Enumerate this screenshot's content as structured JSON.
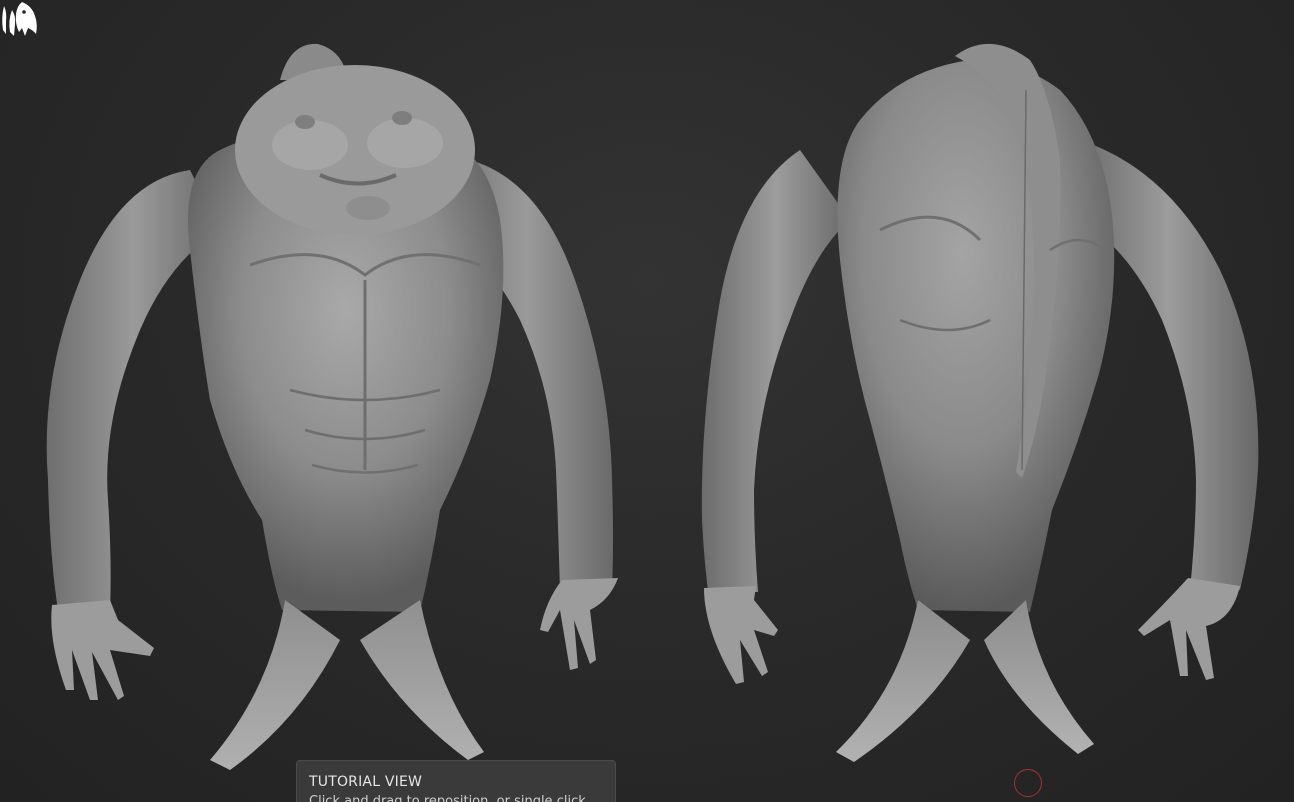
{
  "tutorial": {
    "title": "TUTORIAL VIEW",
    "body": "Click and drag to reposition, or single click"
  },
  "icons": {
    "logo": "zbrush-logo-icon",
    "cursor": "brush-cursor-icon"
  },
  "colors": {
    "background": "#262626",
    "panel": "#3a3a3a",
    "cursor": "#a33232"
  }
}
